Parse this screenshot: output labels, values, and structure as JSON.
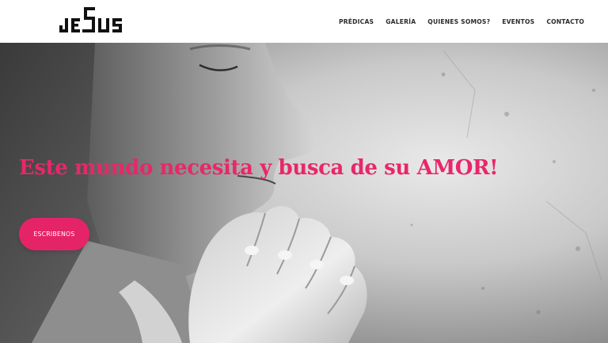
{
  "brand": {
    "logo_text": "JESUS"
  },
  "nav": {
    "items": [
      {
        "label": "PRÉDICAS"
      },
      {
        "label": "GALERÍA"
      },
      {
        "label": "QUIENES SOMOS?"
      },
      {
        "label": "EVENTOS"
      },
      {
        "label": "CONTACTO"
      }
    ]
  },
  "hero": {
    "headline": "Este mundo necesita y busca de su AMOR!",
    "cta_label": "ESCRIBENOS"
  },
  "colors": {
    "accent": "#e52468",
    "headline": "#e8276a",
    "nav_text": "#2b2b2b",
    "header_bg": "#ffffff"
  }
}
